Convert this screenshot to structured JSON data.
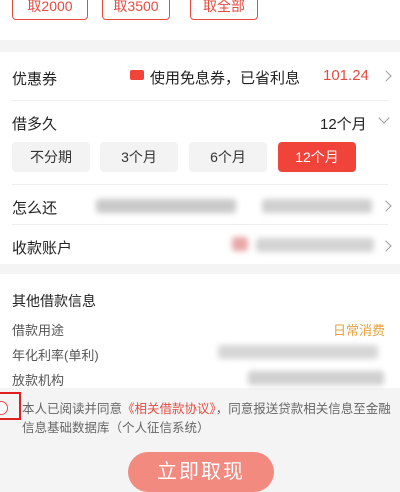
{
  "quick_amounts": [
    "取2000",
    "取3500",
    "取全部"
  ],
  "coupon": {
    "label": "优惠券",
    "text": "使用免息券，已省利息",
    "amount": "101.24"
  },
  "term": {
    "label": "借多久",
    "selected": "12个月",
    "options": [
      "不分期",
      "3个月",
      "6个月",
      "12个月"
    ]
  },
  "repay": {
    "label": "怎么还"
  },
  "account": {
    "label": "收款账户"
  },
  "other_info": {
    "title": "其他借款信息",
    "purpose_label": "借款用途",
    "purpose_value": "日常消费",
    "rate_label": "年化利率(单利)",
    "lender_label": "放款机构"
  },
  "agreement": {
    "prefix": "本人已阅读并同意",
    "link": "《相关借款协议》",
    "suffix": "，同意报送贷款相关信息至金融信息基础数据库（个人征信系统）"
  },
  "submit_label": "立即取现",
  "colors": {
    "accent": "#f0443a",
    "link": "#e64b40",
    "highlight_box": "#e02020"
  }
}
